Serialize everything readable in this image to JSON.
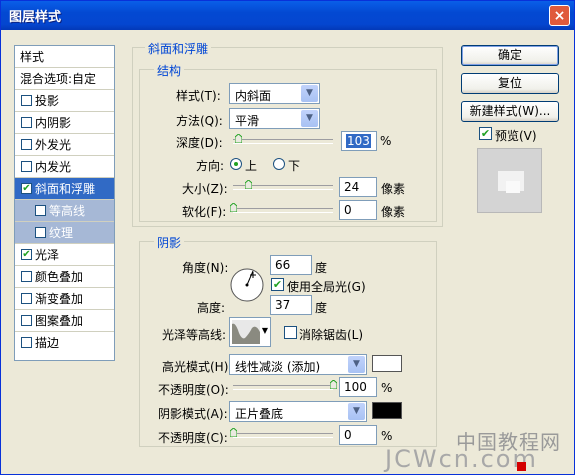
{
  "window": {
    "title": "图层样式",
    "close_label": "×"
  },
  "left_list": {
    "header": "样式",
    "blend": "混合选项:自定",
    "items": [
      {
        "label": "投影",
        "checked": ""
      },
      {
        "label": "内阴影",
        "checked": ""
      },
      {
        "label": "外发光",
        "checked": ""
      },
      {
        "label": "内发光",
        "checked": ""
      },
      {
        "label": "斜面和浮雕",
        "checked": "✔"
      },
      {
        "label": "等高线",
        "checked": ""
      },
      {
        "label": "纹理",
        "checked": ""
      },
      {
        "label": "光泽",
        "checked": "✔"
      },
      {
        "label": "颜色叠加",
        "checked": ""
      },
      {
        "label": "渐变叠加",
        "checked": ""
      },
      {
        "label": "图案叠加",
        "checked": ""
      },
      {
        "label": "描边",
        "checked": ""
      }
    ]
  },
  "bevel": {
    "section_title": "斜面和浮雕",
    "structure_title": "结构",
    "style_label": "样式(T):",
    "style_value": "内斜面",
    "technique_label": "方法(Q):",
    "technique_value": "平滑",
    "depth_label": "深度(D):",
    "depth_value": "103",
    "depth_unit": "%",
    "depth_level": 0.05,
    "direction_label": "方向:",
    "dir_up": "上",
    "dir_down": "下",
    "size_label": "大小(Z):",
    "size_value": "24",
    "size_unit": "像素",
    "size_level": 0.15,
    "soften_label": "软化(F):",
    "soften_value": "0",
    "soften_unit": "像素",
    "soften_level": 0.0
  },
  "shading": {
    "title": "阴影",
    "angle_label": "角度(N):",
    "angle_value": "66",
    "angle_unit": "度",
    "global_light": "使用全局光(G)",
    "global_light_checked": "✔",
    "altitude_label": "高度:",
    "altitude_value": "37",
    "altitude_unit": "度",
    "gloss_label": "光泽等高线:",
    "anti_alias": "消除锯齿(L)",
    "highlight_mode_label": "高光模式(H):",
    "highlight_mode_value": "线性减淡 (添加)",
    "highlight_color": "#FFFFFF",
    "highlight_opacity_label": "不透明度(O):",
    "highlight_opacity_value": "100",
    "highlight_opacity_unit": "%",
    "highlight_opacity_level": 1.0,
    "shadow_mode_label": "阴影模式(A):",
    "shadow_mode_value": "正片叠底",
    "shadow_color": "#000000",
    "shadow_opacity_label": "不透明度(C):",
    "shadow_opacity_value": "0",
    "shadow_opacity_unit": "%",
    "shadow_opacity_level": 0.0
  },
  "buttons": {
    "ok": "确定",
    "reset": "复位",
    "new_style": "新建样式(W)...",
    "preview": "预览(V)",
    "preview_checked": "✔"
  },
  "watermark": {
    "cn": "中国教程网",
    "en": "JCWcn.com"
  }
}
